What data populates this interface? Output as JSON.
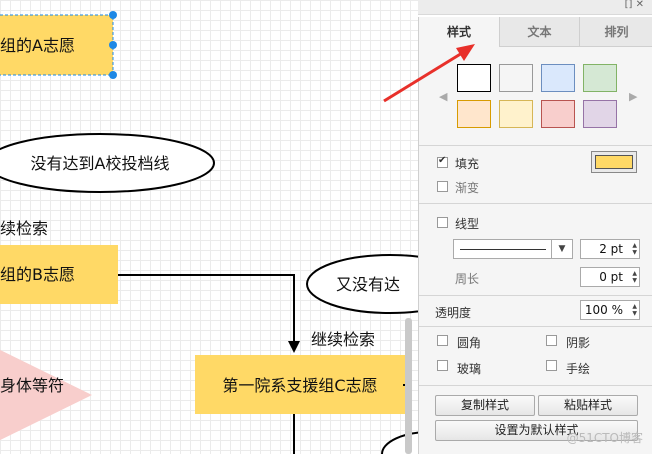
{
  "canvas": {
    "shapes": {
      "top_rect": "组的A志愿",
      "ellipse_1": "没有达到A校投档线",
      "edge_label_1": "续检索",
      "rect_b": "组的B志愿",
      "ellipse_2": "又没有达",
      "edge_label_2": "继续检索",
      "triangle": "身体等符",
      "rect_c": "第一院系支援组C志愿"
    },
    "colors": {
      "shape_fill": "#FFD966",
      "triangle_fill": "#F8CECC",
      "selection": "#1E88E5"
    }
  },
  "panel": {
    "tabs": [
      "样式",
      "文本",
      "排列"
    ],
    "swatches": [
      "#FFFFFF",
      "#F5F5F5",
      "#DAE8FC",
      "#D5E8D4",
      "#FFE6CC",
      "#FFF2CC",
      "#F8CECC",
      "#E1D5E7"
    ],
    "swatch_borders": [
      "#000000",
      "#999999",
      "#6C8EBF",
      "#82B366",
      "#D79B00",
      "#D6B656",
      "#B85450",
      "#9673A6"
    ],
    "fill_label": "填充",
    "fill_color": "#FFD966",
    "gradient_label": "渐变",
    "line_label": "线型",
    "line_width": "2 pt",
    "perimeter_label": "周长",
    "perimeter_value": "0 pt",
    "opacity_label": "透明度",
    "opacity_value": "100 %",
    "options": {
      "rounded": "圆角",
      "shadow": "阴影",
      "glass": "玻璃",
      "sketch": "手绘"
    },
    "copy_style": "复制样式",
    "paste_style": "粘贴样式",
    "set_default": "设置为默认样式"
  },
  "watermark": "@51CTO博客",
  "annotation_color": "#E8302A"
}
